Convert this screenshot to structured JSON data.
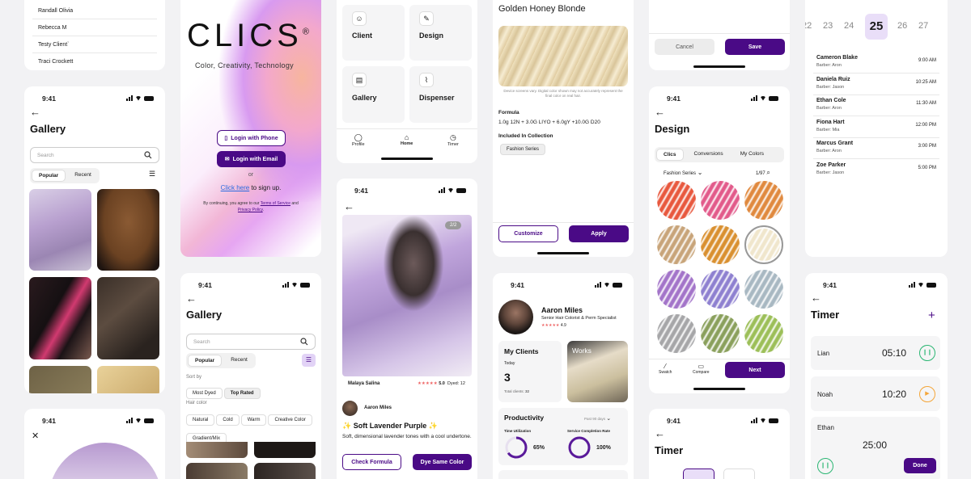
{
  "colors": {
    "accent": "#4a0a86",
    "accent_light": "#e9def8",
    "ring": "#5a1a9a",
    "timer_green": "#2bb673",
    "timer_orange": "#f4a63a"
  },
  "status": {
    "time": "9:41"
  },
  "client_list": {
    "names": [
      "Randall Olivia",
      "Rebecca M",
      "Testy Client`",
      "Traci Crockett"
    ]
  },
  "login": {
    "brand": "CLICS",
    "brand_mark": "®",
    "tagline": "Color, Creativity, Technology",
    "phone_btn": "Login with Phone",
    "email_btn": "Login with Email",
    "or": "or",
    "signup_link": "Click here",
    "signup_rest": " to sign up.",
    "terms_pre": "By continuing, you agree to our ",
    "terms_link": "Terms of Service",
    "terms_and": " and ",
    "privacy_link": "Privacy Policy",
    "terms_end": "."
  },
  "gallery": {
    "title": "Gallery",
    "search_placeholder": "Search",
    "tabs": [
      "Popular",
      "Recent"
    ],
    "sort_label": "Sort by",
    "sort_options": [
      "Most Dyed",
      "Top Rated"
    ],
    "haircolor_label": "Hair color",
    "haircolor_options": [
      "Natural",
      "Cold",
      "Warm",
      "Creative Color",
      "Gradient/Mix"
    ]
  },
  "home": {
    "tiles": [
      {
        "label": "Client",
        "icon": "client-icon"
      },
      {
        "label": "Design",
        "icon": "design-icon"
      },
      {
        "label": "Gallery",
        "icon": "gallery-icon"
      },
      {
        "label": "Dispenser",
        "icon": "dispenser-icon"
      }
    ],
    "nav": [
      "Profile",
      "Home",
      "Timer"
    ]
  },
  "detail": {
    "counter": "2/2",
    "model": "Malaya Salina",
    "stars": "★★★★★",
    "rating": "5.0",
    "dyed": "Dyed: 12",
    "stylist": "Aaron Miles",
    "spark": "✨",
    "name": "Soft Lavender Purple",
    "desc": "Soft, dimensional lavender tones with a cool undertone.",
    "btn_formula": "Check Formula",
    "btn_dye": "Dye Same Color"
  },
  "formula": {
    "title": "Golden Honey Blonde",
    "disclaimer": "Device screens vary. Digital color shown may not accurately represent the final color on real hair.",
    "formula_label": "Formula",
    "formula_text": "1.0g 12N + 3.0G LIYO + 6.0gY +10.0G D20",
    "collection_label": "Included In Collection",
    "collection_chip": "Fashion Series",
    "btn_customize": "Customize",
    "btn_apply": "Apply"
  },
  "profile": {
    "name": "Aaron Miles",
    "role": "Senior Hair Colorist & Perm Specialist",
    "stars": "★★★★★",
    "rating": "4.9",
    "clients_title": "My Clients",
    "today": "Today",
    "count": "3",
    "total": "Total clients: ",
    "total_num": "32",
    "works": "Works",
    "productivity": "Productivity",
    "period": "Past 90 days",
    "time_util_label": "Time Utilization",
    "time_util": "65%",
    "completion_label": "Service Completion Rate",
    "completion": "100%"
  },
  "dialog": {
    "cancel": "Cancel",
    "save": "Save"
  },
  "design": {
    "title": "Design",
    "tabs": [
      "Clics",
      "Conversions",
      "My Colors"
    ],
    "series": "Fashion Series",
    "count": "1/97",
    "nav": [
      "Swatch",
      "Compare"
    ],
    "next": "Next",
    "swatches": [
      "#e8583e",
      "#e25a8a",
      "#e0893e",
      "#c8a479",
      "#d99030",
      "#f0e6cc",
      "#a374c9",
      "#8e80d0",
      "#a8b8c2",
      "#a6a6a8",
      "#8aa05c",
      "#9cbf58"
    ]
  },
  "timer_small": {
    "title": "Timer"
  },
  "schedule": {
    "days": [
      "22",
      "23",
      "24",
      "25",
      "26",
      "27"
    ],
    "appointments": [
      {
        "name": "Cameron Blake",
        "barber": "Barber: Aron",
        "time": "9:00 AM"
      },
      {
        "name": "Daniela Ruiz",
        "barber": "Barber: Jason",
        "time": "10:25 AM"
      },
      {
        "name": "Ethan Cole",
        "barber": "Barber: Aron",
        "time": "11:30 AM"
      },
      {
        "name": "Fiona Hart",
        "barber": "Barber: Mia",
        "time": "12:00 PM"
      },
      {
        "name": "Marcus Grant",
        "barber": "Barber: Aron",
        "time": "3:00 PM"
      },
      {
        "name": "Zoe Parker",
        "barber": "Barber: Jason",
        "time": "5:00 PM"
      }
    ]
  },
  "timer": {
    "title": "Timer",
    "add": "+",
    "rows": [
      {
        "name": "Lian",
        "time": "05:10"
      },
      {
        "name": "Noah",
        "time": "10:20"
      },
      {
        "name": "Ethan",
        "time": "25:00"
      }
    ],
    "done": "Done"
  }
}
